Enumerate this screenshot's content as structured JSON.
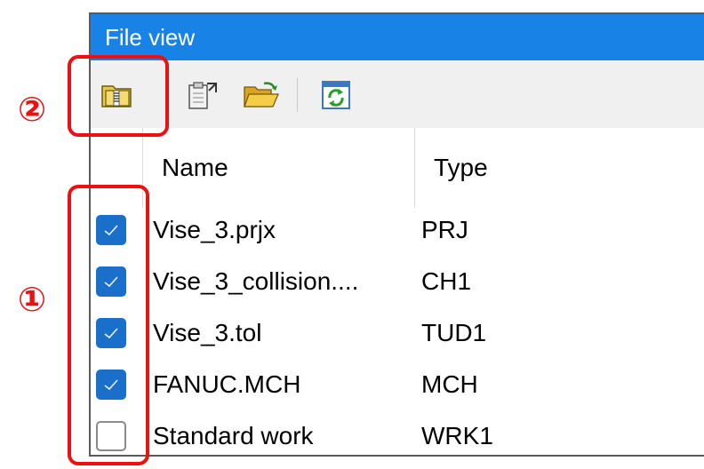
{
  "window": {
    "title": "File view"
  },
  "toolbar": {
    "buttons": [
      {
        "icon": "zip-folder-icon"
      },
      {
        "icon": "clipboard-export-icon"
      },
      {
        "icon": "open-folder-icon"
      },
      {
        "icon": "refresh-icon"
      }
    ]
  },
  "table": {
    "columns": [
      "Name",
      "Type"
    ],
    "rows": [
      {
        "checked": true,
        "name": "Vise_3.prjx",
        "type": "PRJ"
      },
      {
        "checked": true,
        "name": "Vise_3_collision....",
        "type": "CH1"
      },
      {
        "checked": true,
        "name": "Vise_3.tol",
        "type": "TUD1"
      },
      {
        "checked": true,
        "name": "FANUC.MCH",
        "type": "MCH"
      },
      {
        "checked": false,
        "name": "Standard work",
        "type": "WRK1"
      }
    ]
  },
  "annotations": {
    "callout_1": "①",
    "callout_2": "②"
  },
  "colors": {
    "titlebar": "#1982e6",
    "checkbox_checked": "#1a6fcb",
    "annotation_red": "#ee1010"
  }
}
